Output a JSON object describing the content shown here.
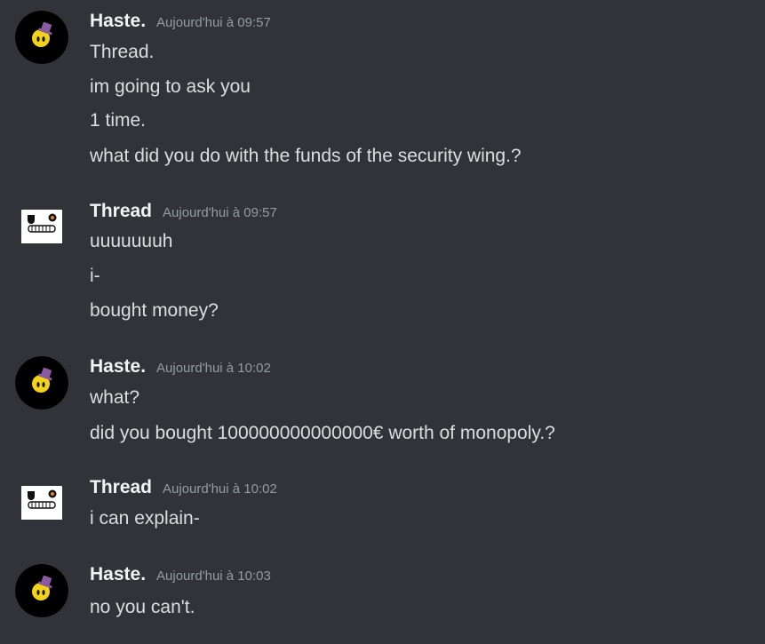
{
  "messages": [
    {
      "author": "Haste.",
      "time": "Aujourd'hui à 09:57",
      "avatar": "yellow-face-tophat-icon",
      "lines": [
        "Thread.",
        "im going to ask you",
        "1 time.",
        "what did you do with the funds of the security wing.?"
      ]
    },
    {
      "author": "Thread",
      "time": "Aujourd'hui à 09:57",
      "avatar": "grinning-face-icon",
      "lines": [
        "uuuuuuuh",
        "i-",
        "bought money?"
      ]
    },
    {
      "author": "Haste.",
      "time": "Aujourd'hui à 10:02",
      "avatar": "yellow-face-tophat-icon",
      "lines": [
        "what?",
        "did you bought 100000000000000€ worth of monopoly.?"
      ]
    },
    {
      "author": "Thread",
      "time": "Aujourd'hui à 10:02",
      "avatar": "grinning-face-icon",
      "lines": [
        "i can explain-"
      ]
    },
    {
      "author": "Haste.",
      "time": "Aujourd'hui à 10:03",
      "avatar": "yellow-face-tophat-icon",
      "lines": [
        "no you can't."
      ]
    }
  ],
  "colors": {
    "background": "#323338",
    "username": "#f2f3f5",
    "text": "#dbdee1",
    "timestamp": "#949ba4",
    "haste_avatar_bg": "#000000",
    "haste_face": "#f2d21b",
    "haste_hat": "#8a5a9e",
    "thread_avatar_bg": "#ffffff"
  }
}
